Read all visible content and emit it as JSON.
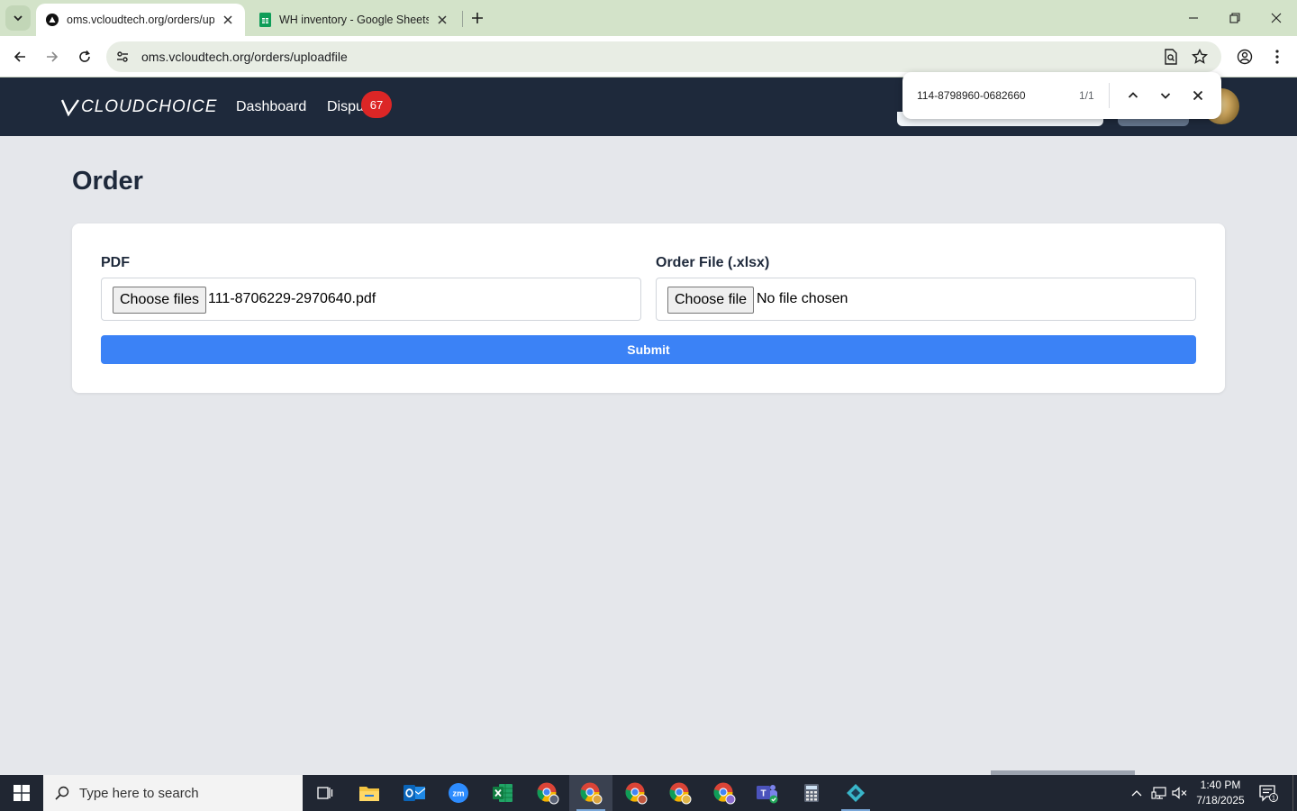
{
  "browser": {
    "tabs": [
      {
        "title": "oms.vcloudtech.org/orders/upl",
        "active": true
      },
      {
        "title": "WH inventory - Google Sheets",
        "active": false
      }
    ],
    "url": "oms.vcloudtech.org/orders/uploadfile"
  },
  "find_bar": {
    "query": "114-8798960-0682660",
    "count": "1/1"
  },
  "navbar": {
    "logo": "CLOUDCHOICE",
    "links": [
      "Dashboard",
      "Dispu"
    ],
    "badge": "67"
  },
  "page": {
    "title": "Order",
    "pdf_field": {
      "label": "PDF",
      "button": "Choose files",
      "value": "111-8706229-2970640.pdf"
    },
    "order_field": {
      "label": "Order File (.xlsx)",
      "button": "Choose file",
      "value": "No file chosen"
    },
    "submit": "Submit"
  },
  "taskbar": {
    "search_placeholder": "Type here to search",
    "time": "1:40 PM",
    "date": "7/18/2025",
    "notifications": "1"
  },
  "colors": {
    "navbar_bg": "#1e293b",
    "submit_bg": "#3b82f6",
    "badge_bg": "#dc2626",
    "page_bg": "#e5e7eb"
  }
}
